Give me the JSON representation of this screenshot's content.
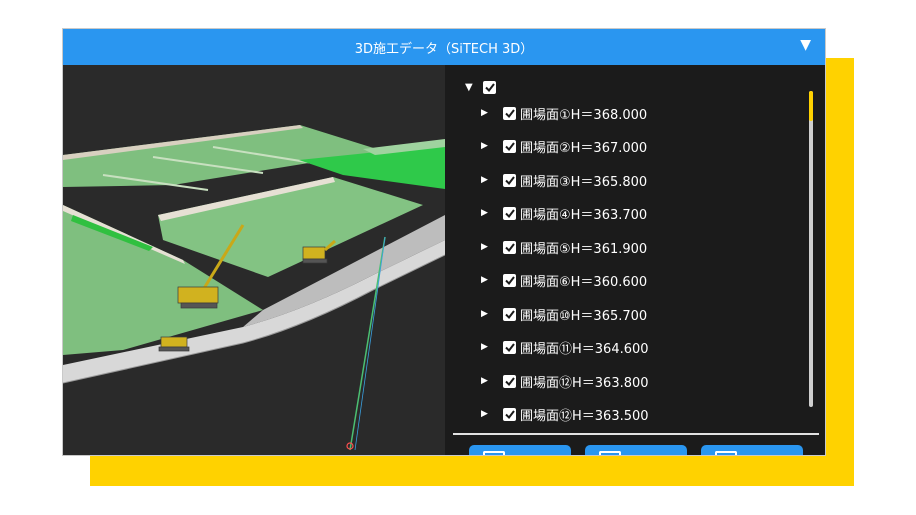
{
  "window": {
    "title": "3D施工データ（SiTECH 3D）",
    "collapse_icon": "▼"
  },
  "tree": {
    "root_toggle": "▼",
    "item_toggle": "▶",
    "items": [
      {
        "label": "圃場面①H＝368.000",
        "checked": true
      },
      {
        "label": "圃場面②H＝367.000",
        "checked": true
      },
      {
        "label": "圃場面③H＝365.800",
        "checked": true
      },
      {
        "label": "圃場面④H＝363.700",
        "checked": true
      },
      {
        "label": "圃場面⑤H＝361.900",
        "checked": true
      },
      {
        "label": "圃場面⑥H＝360.600",
        "checked": true
      },
      {
        "label": "圃場面⑩H＝365.700",
        "checked": true
      },
      {
        "label": "圃場面⑪H＝364.600",
        "checked": true
      },
      {
        "label": "圃場面⑫H＝363.800",
        "checked": true
      },
      {
        "label": "圃場面⑫H＝363.500",
        "checked": true
      }
    ]
  },
  "colors": {
    "accent": "#2a96f0",
    "backdrop": "#ffd200",
    "panel": "#1b1b1b"
  },
  "icons": {
    "checkbox": "check-icon",
    "bottom_buttons": [
      "panel-icon",
      "panel-icon",
      "panel-icon"
    ]
  }
}
